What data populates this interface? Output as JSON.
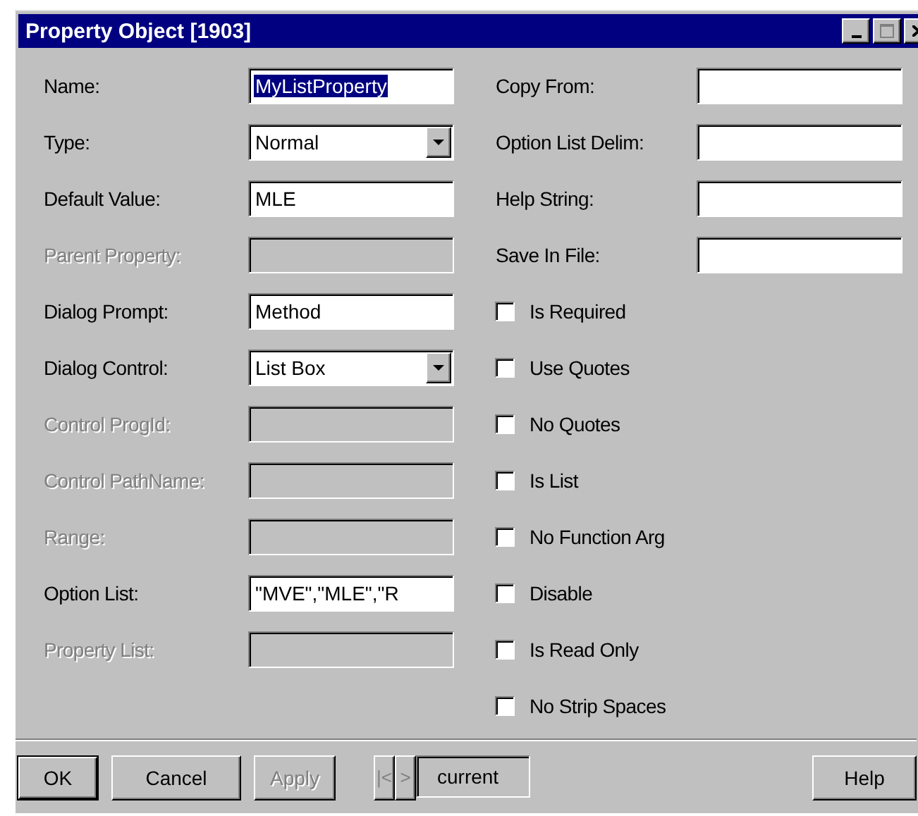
{
  "window": {
    "title": "Property Object [1903]"
  },
  "left_fields": [
    {
      "label": "Name:",
      "kind": "text",
      "value": "MyListProperty",
      "text_selected": true,
      "disabled": false
    },
    {
      "label": "Type:",
      "kind": "combo",
      "value": "Normal",
      "disabled": false
    },
    {
      "label": "Default Value:",
      "kind": "text",
      "value": "MLE",
      "text_selected": false,
      "disabled": false
    },
    {
      "label": "Parent Property:",
      "kind": "text",
      "disabled": true
    },
    {
      "label": "Dialog Prompt:",
      "kind": "text",
      "value": "Method",
      "text_selected": false,
      "disabled": false
    },
    {
      "label": "Dialog Control:",
      "kind": "combo",
      "value": "List Box",
      "disabled": false
    },
    {
      "label": "Control ProgId:",
      "kind": "text",
      "disabled": true
    },
    {
      "label": "Control PathName:",
      "kind": "text",
      "disabled": true
    },
    {
      "label": "Range:",
      "kind": "text",
      "disabled": true
    },
    {
      "label": "Option List:",
      "kind": "text",
      "value": "\"MVE\",\"MLE\",\"R",
      "text_selected": false,
      "disabled": false
    },
    {
      "label": "Property List:",
      "kind": "text",
      "disabled": true
    }
  ],
  "right_fields": [
    {
      "label": "Copy From:",
      "kind": "text",
      "disabled": false
    },
    {
      "label": "Option List Delim:",
      "kind": "text",
      "disabled": false
    },
    {
      "label": "Help String:",
      "kind": "text",
      "disabled": false
    },
    {
      "label": "Save In File:",
      "kind": "text",
      "disabled": false
    }
  ],
  "checkboxes": [
    {
      "label": "Is Required",
      "checked": false
    },
    {
      "label": "Use Quotes",
      "checked": false
    },
    {
      "label": "No Quotes",
      "checked": false
    },
    {
      "label": "Is List",
      "checked": false
    },
    {
      "label": "No Function Arg",
      "checked": false
    },
    {
      "label": "Disable",
      "checked": false
    },
    {
      "label": "Is Read Only",
      "checked": false
    },
    {
      "label": "No Strip Spaces",
      "checked": false
    }
  ],
  "buttons": [
    {
      "label": "OK",
      "default": true,
      "disabled": false
    },
    {
      "label": "Cancel",
      "default": false,
      "disabled": false
    },
    {
      "label": "Apply",
      "default": false,
      "disabled": true
    }
  ],
  "nav": [
    {
      "label": "|<",
      "disabled": true
    },
    {
      "label": ">",
      "disabled": true
    }
  ],
  "current": "current",
  "help_button": {
    "label": "Help"
  }
}
